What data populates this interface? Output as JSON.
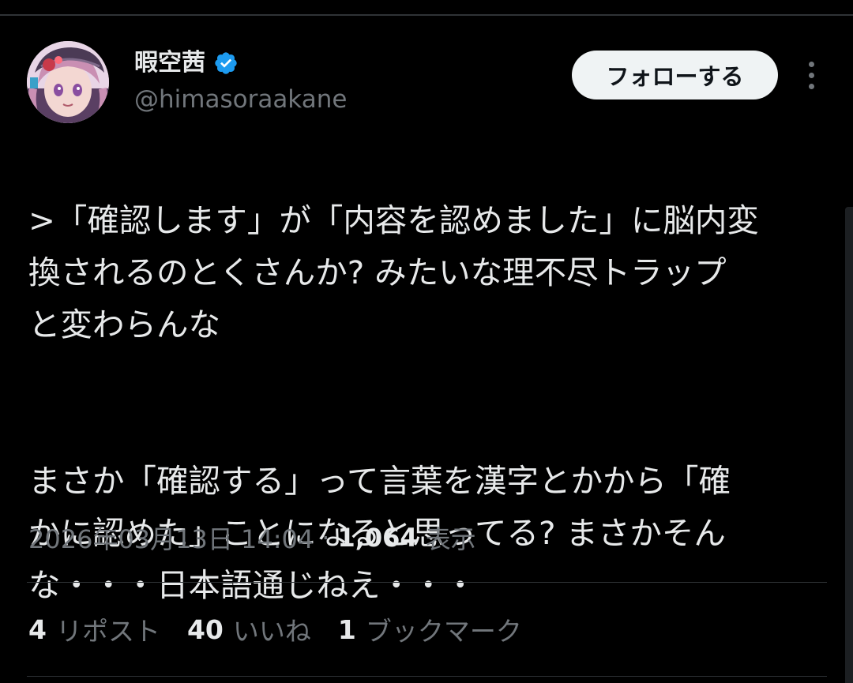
{
  "user": {
    "display_name": "暇空茜",
    "handle": "@himasoraakane",
    "verified": true,
    "avatar_icon": "anime-character-avatar"
  },
  "actions": {
    "follow_label": "フォローする",
    "more_icon": "more-vertical-icon"
  },
  "tweet": {
    "paragraphs": [
      ">「確認します」が「内容を認めました」に脳内変\n換されるのとくさんか? みたいな理不尽トラップ\nと変わらんな",
      "まさか「確認する」って言葉を漢字とかから「確\nかに認めた」ことになると思ってる? まさかそん\nな・・・日本語通じねえ・・・"
    ]
  },
  "meta": {
    "timestamp": "2026年03月13日 14:04",
    "separator": "·",
    "views_count": "1,064",
    "views_label": "表示"
  },
  "stats": {
    "reposts_count": "4",
    "reposts_label": "リポスト",
    "likes_count": "40",
    "likes_label": "いいね",
    "bookmarks_count": "1",
    "bookmarks_label": "ブックマーク"
  },
  "colors": {
    "background": "#000000",
    "text_primary": "#e7e9ea",
    "text_secondary": "#71767b",
    "verified_blue": "#1d9bf0",
    "divider": "#2f3336",
    "follow_button_bg": "#eff3f4"
  }
}
